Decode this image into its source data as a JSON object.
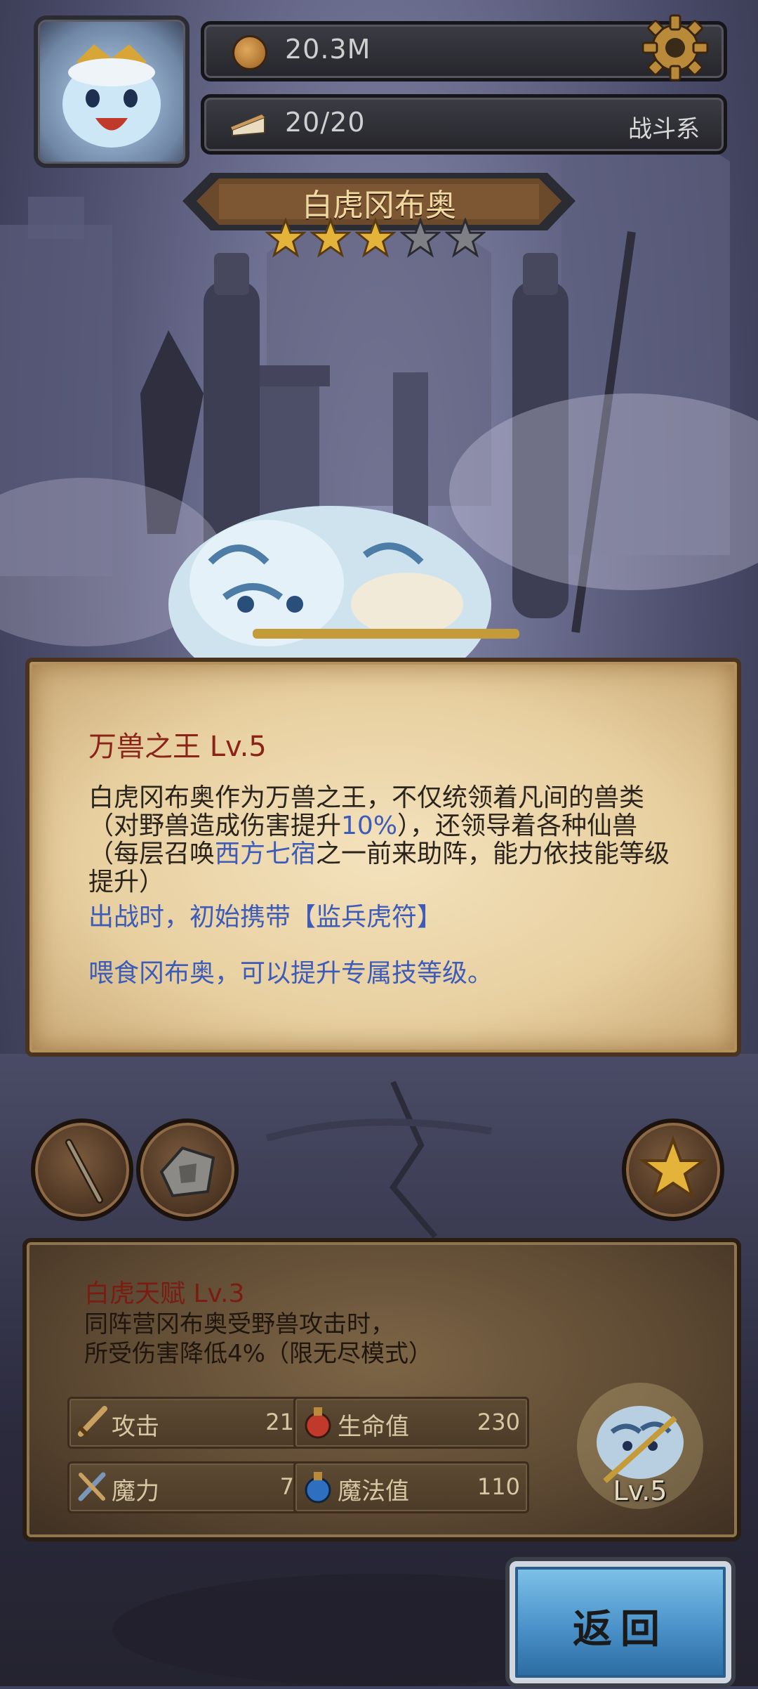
{
  "header": {
    "coins": "20.3M",
    "stamina": "20/20",
    "class_tag": "战斗系"
  },
  "hero": {
    "name": "白虎冈布奥",
    "stars_filled": 3,
    "stars_total": 5
  },
  "skill": {
    "title": "万兽之王 Lv.5",
    "desc_p1_a": "白虎冈布奥作为万兽之王，不仅统领着凡间的兽类（对野兽造成伤害提升",
    "desc_p1_b": "10%",
    "desc_p1_c": "），还领导着各种仙兽（每层召唤",
    "desc_p1_d": "西方七宿",
    "desc_p1_e": "之一前来助阵，能力依技能等级提升）",
    "desc_p2": "出战时，初始携带【监兵虎符】",
    "desc_p3": "喂食冈布奥，可以提升专属技等级。"
  },
  "talent": {
    "title": "白虎天赋 Lv.3",
    "line1": "同阵营冈布奥受野兽攻击时，",
    "line2": "所受伤害降低4%（限无尽模式）"
  },
  "stats": {
    "attack_label": "攻击",
    "attack_value": "21",
    "hp_label": "生命值",
    "hp_value": "230",
    "magic_label": "魔力",
    "magic_value": "7",
    "mp_label": "魔法值",
    "mp_value": "110"
  },
  "pet": {
    "level": "Lv.5"
  },
  "buttons": {
    "return_label": "返回"
  },
  "icons": {
    "coin": "coin-icon",
    "stamina": "cake-icon",
    "settings": "gear-icon",
    "weapon": "sword-icon",
    "map": "stone-tablet-icon",
    "favorite": "star-icon",
    "attack": "sword-icon",
    "hp": "red-potion-icon",
    "magic": "staff-icon",
    "mp": "blue-potion-icon"
  },
  "colors": {
    "skill_title": "#8a2418",
    "highlight_blue": "#3d5bb8",
    "star_gold": "#e4b43a",
    "star_empty": "#7f7f86",
    "return_button": "#4a92c9"
  }
}
